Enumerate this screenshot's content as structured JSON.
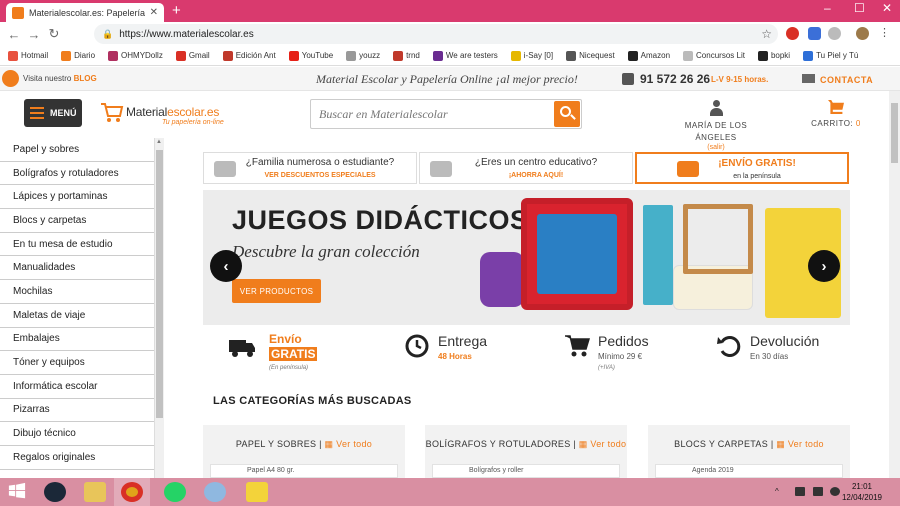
{
  "browser": {
    "tab_title": "Materialescolar.es: Papelería Onl",
    "url": "https://www.materialescolar.es",
    "bookmarks": [
      {
        "label": "Hotmail",
        "color": "#e8523f"
      },
      {
        "label": "Diario",
        "color": "#f07d1c"
      },
      {
        "label": "OHMYDollz",
        "color": "#b03060"
      },
      {
        "label": "Gmail",
        "color": "#d93025"
      },
      {
        "label": "Edición Ant",
        "color": "#c0392b"
      },
      {
        "label": "YouTube",
        "color": "#e62117"
      },
      {
        "label": "youzz",
        "color": "#999999"
      },
      {
        "label": "trnd",
        "color": "#c0392b"
      },
      {
        "label": "We are testers",
        "color": "#6a2c91"
      },
      {
        "label": "i-Say [0]",
        "color": "#e6b800"
      },
      {
        "label": "Nicequest",
        "color": "#555555"
      },
      {
        "label": "Amazon",
        "color": "#222222"
      },
      {
        "label": "Concursos Lit",
        "color": "#bbbbbb"
      },
      {
        "label": "bopki",
        "color": "#222222"
      },
      {
        "label": "Tu Piel y Tú",
        "color": "#2e6fd8"
      }
    ]
  },
  "topbar": {
    "blog_prefix": "Visita nuestro",
    "blog_link": "BLOG",
    "slogan": "Material Escolar y Papelería Online ¡al mejor precio!",
    "phone": "91 572 26 26",
    "hours": "L-V 9-15 horas.",
    "contact": "CONTACTA"
  },
  "header": {
    "menu_label": "MENÚ",
    "logo_main": "Material",
    "logo_accent": "escolar.es",
    "logo_tagline": "Tu papelería on-line",
    "search_placeholder": "Buscar en Materialescolar",
    "account_name_line1": "MARÍA DE LOS",
    "account_name_line2": "ÁNGELES",
    "account_logout": "(salir)",
    "cart_label": "CARRITO:",
    "cart_count": "0"
  },
  "sidebar": {
    "items": [
      "Papel y sobres",
      "Bolígrafos y rotuladores",
      "Lápices y portaminas",
      "Blocs y carpetas",
      "En tu mesa de estudio",
      "Manualidades",
      "Mochilas",
      "Maletas de viaje",
      "Embalajes",
      "Tóner y equipos",
      "Informática escolar",
      "Pizarras",
      "Dibujo técnico",
      "Regalos originales"
    ]
  },
  "features": [
    {
      "title": "¿Familia numerosa o estudiante?",
      "sub": "VER DESCUENTOS ESPECIALES"
    },
    {
      "title": "¿Eres un centro educativo?",
      "sub": "¡AHORRA AQUÍ!"
    },
    {
      "title": "¡ENVÍO GRATIS!",
      "sub": "en la península"
    }
  ],
  "banner": {
    "title": "JUEGOS DIDÁCTICOS",
    "subtitle": "Descubre la gran colección",
    "cta": "VER PRODUCTOS"
  },
  "benefits": {
    "shipping_line1": "Envío",
    "shipping_line2": "GRATIS",
    "shipping_note": "(En península)",
    "delivery_title": "Entrega",
    "delivery_sub": "48 Horas",
    "orders_title": "Pedidos",
    "orders_sub": "Mínimo 29 €",
    "orders_note": "(+IVA)",
    "returns_title": "Devolución",
    "returns_sub": "En 30 días"
  },
  "categories_title": "LAS CATEGORÍAS MÁS BUSCADAS",
  "categories": [
    {
      "name": "PAPEL Y SOBRES",
      "link": "Ver todo",
      "first_item": "Papel A4 80 gr."
    },
    {
      "name": "BOLÍGRAFOS Y ROTULADORES",
      "link": "Ver todo",
      "first_item": "Bolígrafos y roller"
    },
    {
      "name": "BLOCS Y CARPETAS",
      "link": "Ver todo",
      "first_item": "Agenda 2019"
    }
  ],
  "taskbar": {
    "time": "21:01",
    "date": "12/04/2019"
  },
  "colors": {
    "accent": "#f07d1c",
    "chrome_tabstrip": "#d93a6e",
    "taskbar": "#d98fa2"
  }
}
